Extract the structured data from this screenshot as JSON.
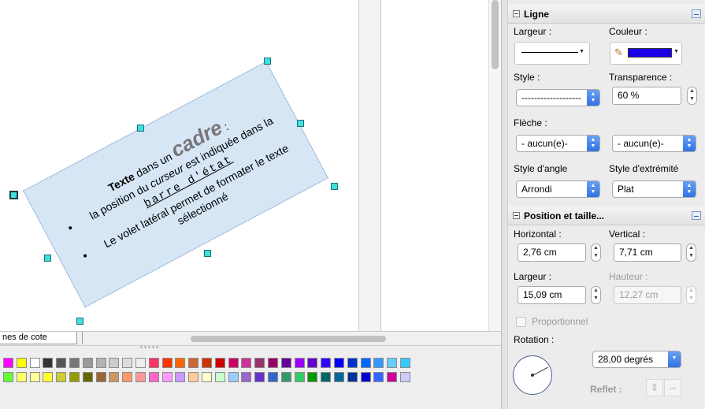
{
  "document": {
    "frame_title_bold": "Texte",
    "frame_title_mid": " dans un ",
    "frame_title_big": "cadre",
    "frame_title_end": " :",
    "bullet1_start": "la position du ",
    "bullet1_italic": "curseur",
    "bullet1_mid": " est indiquée dans la",
    "bullet1_mono": "barre d'état",
    "bullet2": "Le volet latéral permet de formater le texte sélectionné"
  },
  "tabs": {
    "active_label": "nes de cote"
  },
  "palette": {
    "row1": [
      "#ff00ff",
      "#ffff00",
      "#ffffff",
      "#333333",
      "#555555",
      "#777777",
      "#999999",
      "#b2b2b2",
      "#cccccc",
      "#dddddd",
      "#eeeeee",
      "#ff3366",
      "#ff3300",
      "#ff6600",
      "#cc6633",
      "#cc3300",
      "#cc0000",
      "#cc0066",
      "#cc3399",
      "#993366",
      "#990066",
      "#660099",
      "#9900ff",
      "#6600cc",
      "#3300ff",
      "#0000ff",
      "#0033cc",
      "#0066ff",
      "#3399ff",
      "#66ccff",
      "#33ccff"
    ],
    "row2": [
      "#66ff33",
      "#ffff66",
      "#ffff99",
      "#ffff33",
      "#cccc33",
      "#999900",
      "#666600",
      "#996633",
      "#cc9966",
      "#ff9966",
      "#ff9999",
      "#ff66cc",
      "#ff99ff",
      "#cc99ff",
      "#ffcc99",
      "#ffffcc",
      "#ccffcc",
      "#99ccff",
      "#9966cc",
      "#6633cc",
      "#3366cc",
      "#339966",
      "#33cc66",
      "#009900",
      "#006666",
      "#006699",
      "#003399",
      "#0000cc",
      "#3366ff",
      "#cc0099",
      "#ccccff"
    ]
  },
  "sidebar": {
    "ligne": {
      "title": "Ligne",
      "largeur_label": "Largeur :",
      "couleur_label": "Couleur :",
      "couleur_value": "#1a00e6",
      "style_label": "Style :",
      "style_value": "-------------------",
      "transparence_label": "Transparence :",
      "transparence_value": "60 %",
      "fleche_label": "Flèche :",
      "fleche_left": "- aucun(e)-",
      "fleche_right": "- aucun(e)-",
      "angle_label": "Style d'angle",
      "angle_value": "Arrondi",
      "extremite_label": "Style d'extrémité",
      "extremite_value": "Plat"
    },
    "position": {
      "title": "Position et taille...",
      "horizontal_label": "Horizontal :",
      "horizontal_value": "2,76 cm",
      "vertical_label": "Vertical :",
      "vertical_value": "7,71 cm",
      "largeur_label": "Largeur :",
      "largeur_value": "15,09 cm",
      "hauteur_label": "Hauteur :",
      "hauteur_value": "12,27 cm",
      "proportionnel_label": "Proportionnel",
      "rotation_label": "Rotation :",
      "rotation_value": "28,00 degrés",
      "reflet_label": "Reflet :"
    }
  }
}
